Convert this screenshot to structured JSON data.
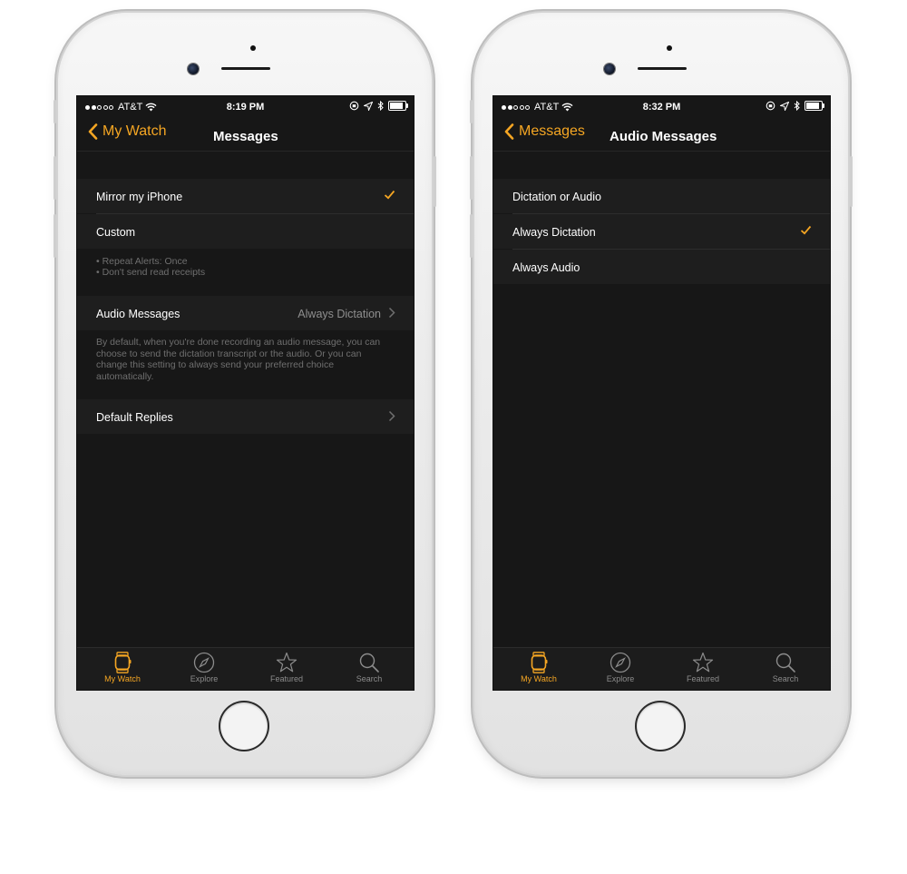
{
  "colors": {
    "accent": "#f5a623",
    "screen_bg": "#171717",
    "row_bg": "#1e1e1e",
    "muted": "#8e8e8e"
  },
  "left_screen": {
    "status": {
      "carrier": "AT&T",
      "time": "8:19 PM"
    },
    "nav": {
      "back_label": "My Watch",
      "title": "Messages"
    },
    "rows": {
      "mirror": "Mirror my iPhone",
      "custom": "Custom",
      "custom_note_1": "• Repeat Alerts: Once",
      "custom_note_2": "• Don't send read receipts",
      "audio_messages": "Audio Messages",
      "audio_messages_value": "Always Dictation",
      "audio_note": "By default, when you're done recording an audio message, you can choose to send the dictation transcript or the audio. Or you can change this setting to always send your preferred choice automatically.",
      "default_replies": "Default Replies"
    },
    "selected": "Mirror my iPhone"
  },
  "right_screen": {
    "status": {
      "carrier": "AT&T",
      "time": "8:32 PM"
    },
    "nav": {
      "back_label": "Messages",
      "title": "Audio Messages"
    },
    "options": [
      "Dictation or Audio",
      "Always Dictation",
      "Always Audio"
    ],
    "selected": "Always Dictation"
  },
  "tabs": [
    {
      "label": "My Watch",
      "icon": "watch-icon",
      "active": true
    },
    {
      "label": "Explore",
      "icon": "compass-icon",
      "active": false
    },
    {
      "label": "Featured",
      "icon": "star-icon",
      "active": false
    },
    {
      "label": "Search",
      "icon": "search-icon",
      "active": false
    }
  ]
}
